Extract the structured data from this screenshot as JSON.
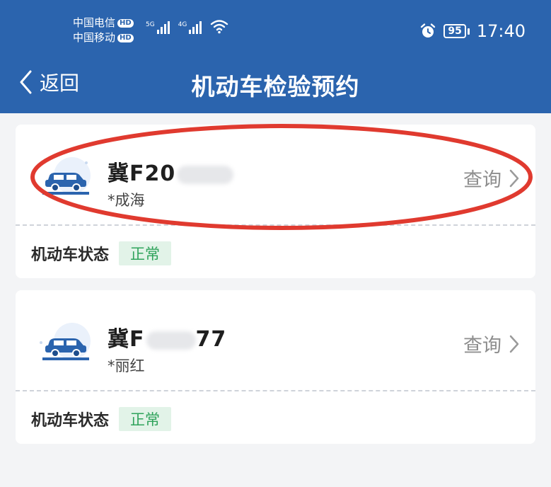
{
  "status_bar": {
    "carrier_1": "中国电信",
    "carrier_2": "中国移动",
    "hd_badge": "HD",
    "signal_1_type": "5G",
    "signal_2_type": "4G",
    "battery": "95",
    "time": "17:40"
  },
  "header": {
    "back_label": "返回",
    "title": "机动车检验预约"
  },
  "vehicles": [
    {
      "plate": "冀F20",
      "owner": "*成海",
      "query_label": "查询",
      "status_label": "机动车状态",
      "status_value": "正常"
    },
    {
      "plate": "冀F",
      "plate_tail": "77",
      "owner": "*丽红",
      "query_label": "查询",
      "status_label": "机动车状态",
      "status_value": "正常"
    }
  ],
  "colors": {
    "header_bg": "#2b64ae",
    "status_ok_text": "#2fa35b",
    "status_ok_bg": "#e2f3e8",
    "highlight_ring": "#e03a2f"
  }
}
